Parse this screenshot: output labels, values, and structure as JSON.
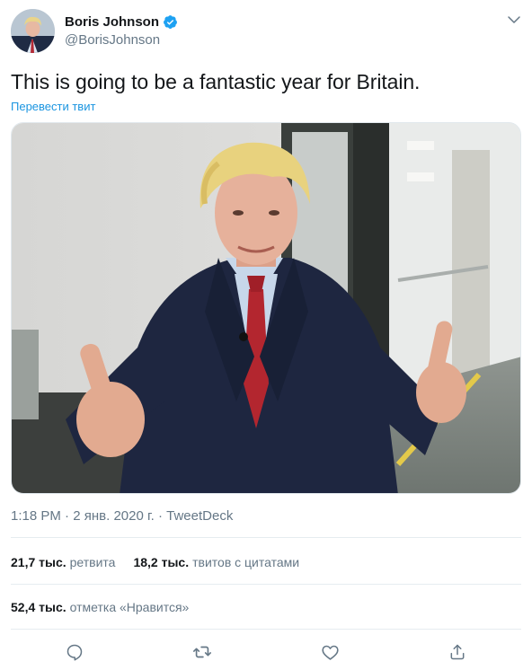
{
  "user": {
    "display_name": "Boris Johnson",
    "handle": "@BorisJohnson",
    "verified": true
  },
  "tweet": {
    "text": "This is going to be a fantastic year for Britain.",
    "translate_label": "Перевести твит",
    "time": "1:18 PM",
    "separator": "·",
    "date": "2 янв. 2020 г.",
    "source": "TweetDeck"
  },
  "stats": {
    "retweets_value": "21,7 тыс.",
    "retweets_label": "ретвита",
    "quotes_value": "18,2 тыс.",
    "quotes_label": "твитов с цитатами",
    "likes_value": "52,4 тыс.",
    "likes_label": "отметка «Нравится»"
  },
  "actions": [
    "reply-icon",
    "retweet-icon",
    "like-icon",
    "share-icon"
  ],
  "colors": {
    "accent": "#1da1f2",
    "link": "#1b95e0",
    "secondary_text": "#657786",
    "divider": "#e6ecf0"
  }
}
